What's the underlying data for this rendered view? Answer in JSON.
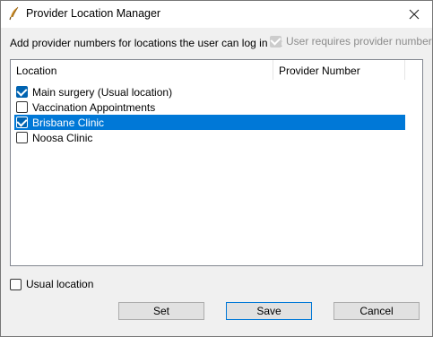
{
  "window": {
    "title": "Provider Location Manager"
  },
  "icons": {
    "app": "quill-pen-icon",
    "close": "close-icon"
  },
  "instruction": "Add provider numbers for locations the user can log in at:",
  "requires_provider": {
    "label": "User requires provider number",
    "checked": true,
    "disabled": true
  },
  "table": {
    "columns": [
      "Location",
      "Provider Number"
    ],
    "rows": [
      {
        "location": "Main surgery (Usual location)",
        "provider_number": "",
        "checked": true,
        "selected": false
      },
      {
        "location": "Vaccination Appointments",
        "provider_number": "",
        "checked": false,
        "selected": false
      },
      {
        "location": "Brisbane Clinic",
        "provider_number": "",
        "checked": true,
        "selected": true
      },
      {
        "location": "Noosa Clinic",
        "provider_number": "",
        "checked": false,
        "selected": false
      }
    ]
  },
  "usual_location": {
    "label": "Usual location",
    "checked": false
  },
  "buttons": {
    "set": "Set",
    "save": "Save",
    "cancel": "Cancel"
  },
  "colors": {
    "selection": "#0078d7",
    "checkbox_checked": "#0063b1",
    "disabled_text": "#8c8c8c"
  }
}
